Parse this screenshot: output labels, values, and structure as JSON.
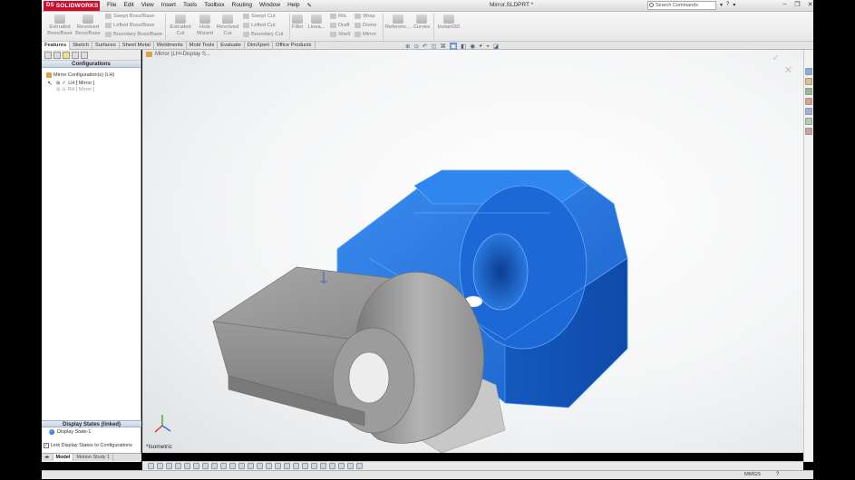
{
  "app": {
    "logo_text": "SOLIDWORKS",
    "logo_mark": "DS",
    "document_title": "Mirror.SLDPRT *",
    "search_placeholder": "Search Commands"
  },
  "menu": [
    "File",
    "Edit",
    "View",
    "Insert",
    "Tools",
    "Toolbox",
    "Routing",
    "Window",
    "Help"
  ],
  "command_manager": {
    "extruded_boss": "Extruded\nBoss/Base",
    "revolved_boss": "Revolved\nBoss/Base",
    "swept_boss": "Swept Boss/Base",
    "lofted_boss": "Lofted Boss/Base",
    "boundary_boss": "Boundary Boss/Base",
    "extruded_cut": "Extruded\nCut",
    "hole_wizard": "Hole\nWizard",
    "revolved_cut": "Revolved\nCut",
    "swept_cut": "Swept Cut",
    "lofted_cut": "Lofted Cut",
    "boundary_cut": "Boundary Cut",
    "fillet": "Fillet",
    "linear_pattern": "Linea...",
    "rib": "Rib",
    "draft": "Draft",
    "shell": "Shell",
    "wrap": "Wrap",
    "dome": "Dome",
    "mirror": "Mirror",
    "reference": "Referenc...",
    "curves": "Curves",
    "instant3d": "Instant3D"
  },
  "tabs": [
    {
      "label": "Features",
      "active": true
    },
    {
      "label": "Sketch",
      "active": false
    },
    {
      "label": "Surfaces",
      "active": false
    },
    {
      "label": "Sheet Metal",
      "active": false
    },
    {
      "label": "Weldments",
      "active": false
    },
    {
      "label": "Mold Tools",
      "active": false
    },
    {
      "label": "Evaluate",
      "active": false
    },
    {
      "label": "DimXpert",
      "active": false
    },
    {
      "label": "Office Products",
      "active": false
    }
  ],
  "config_panel": {
    "header": "Configurations",
    "root": "Mirror Configuration(s) (LH)",
    "items": [
      {
        "label": "LH [ Mirror ]",
        "active": true
      },
      {
        "label": "RH [ Mirror ]",
        "active": false
      }
    ],
    "display_states_header": "Display States (linked)",
    "display_state": "Display State-1",
    "link_label": "Link Display States to Configurations",
    "link_checked": "✓"
  },
  "viewport": {
    "breadcrumb": "Mirror  (LH<Display S...",
    "view_label": "*Isometric",
    "confirm_icon": "✓",
    "cancel_icon": "✕"
  },
  "bottom_tabs": [
    {
      "label": "Model",
      "active": true
    },
    {
      "label": "Motion Study 1",
      "active": false
    }
  ],
  "status": {
    "units": "MMGS",
    "help": "?"
  },
  "colors": {
    "mirror_blue": "#1f6fd6",
    "part_gray": "#9a9a9a",
    "logo_red": "#c8102e"
  }
}
